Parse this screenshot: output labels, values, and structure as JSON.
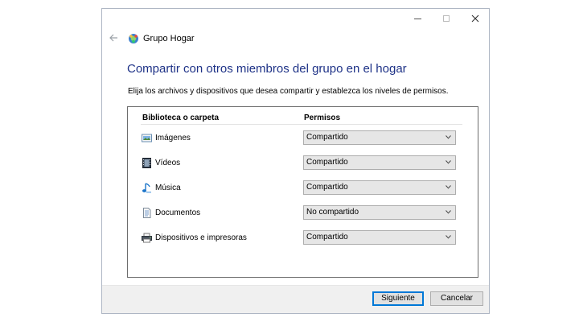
{
  "window": {
    "title": "Grupo Hogar",
    "controls": {
      "minimize": "minimize-icon",
      "maximize": "maximize-icon",
      "close": "close-icon"
    }
  },
  "nav": {
    "back_icon": "back-arrow-icon",
    "app_icon": "homegroup-icon"
  },
  "main": {
    "heading": "Compartir con otros miembros del grupo en el hogar",
    "description": "Elija los archivos y dispositivos que desea compartir y establezca los niveles de permisos.",
    "table": {
      "col_library": "Biblioteca o carpeta",
      "col_permissions": "Permisos",
      "rows": [
        {
          "label": "Imágenes",
          "icon": "pictures-icon",
          "permission": "Compartido"
        },
        {
          "label": "Vídeos",
          "icon": "videos-icon",
          "permission": "Compartido"
        },
        {
          "label": "Música",
          "icon": "music-icon",
          "permission": "Compartido"
        },
        {
          "label": "Documentos",
          "icon": "documents-icon",
          "permission": "No compartido"
        },
        {
          "label": "Dispositivos e impresoras",
          "icon": "printer-icon",
          "permission": "Compartido"
        }
      ]
    }
  },
  "footer": {
    "next_label": "Siguiente",
    "cancel_label": "Cancelar"
  },
  "colors": {
    "heading": "#1e3287",
    "accent": "#0078d7",
    "footer_bg": "#f0f0f0"
  }
}
